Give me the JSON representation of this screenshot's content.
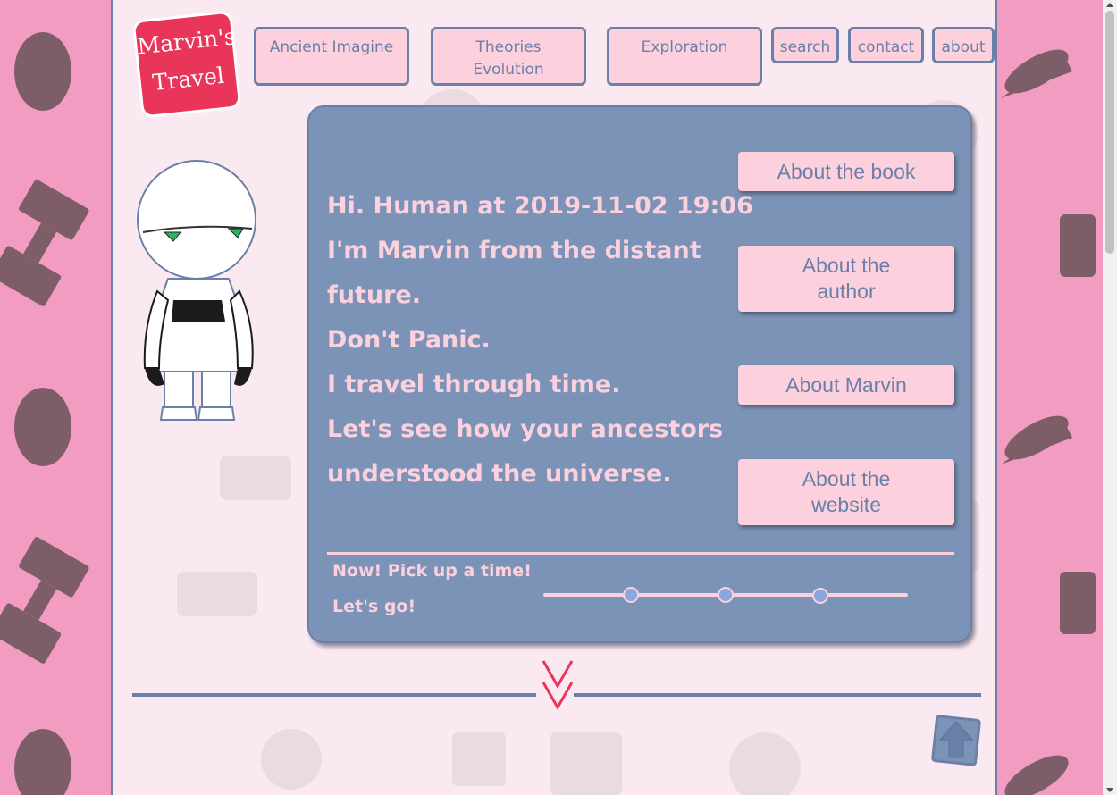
{
  "logo": {
    "line1": "Marvin's",
    "line2": "Travel"
  },
  "nav": [
    {
      "label": "Ancient Imagine"
    },
    {
      "label": "Theories Evolution"
    },
    {
      "label": "Exploration"
    },
    {
      "label": "search"
    },
    {
      "label": "contact"
    },
    {
      "label": "about"
    }
  ],
  "message": {
    "line1": "Hi. Human at 2019-11-02 19:06",
    "line2": "I'm Marvin from the distant",
    "line3": "future.",
    "line4": "Don't Panic.",
    "line5": "I travel through time.",
    "line6": "Let's see how your ancestors",
    "line7": "understood the universe."
  },
  "side_buttons": [
    {
      "label": "About the book"
    },
    {
      "label": "About the author"
    },
    {
      "label": "About Marvin"
    },
    {
      "label": "About the website"
    }
  ],
  "time_picker": {
    "prompt": "Now! Pick up a time!",
    "go": "Let's go!",
    "knob_fractions": [
      0.24,
      0.5,
      0.76
    ]
  },
  "icons": {
    "scroll_down": "chevron-double-down-icon",
    "back_to_top": "arrow-up-icon"
  },
  "colors": {
    "outer_bg": "#f29cc2",
    "page_bg": "#fbe9f1",
    "accent_blue": "#6a80a8",
    "panel_bg": "#7b93b6",
    "pink_text": "#fcd0dc",
    "logo_red": "#e9355a"
  }
}
